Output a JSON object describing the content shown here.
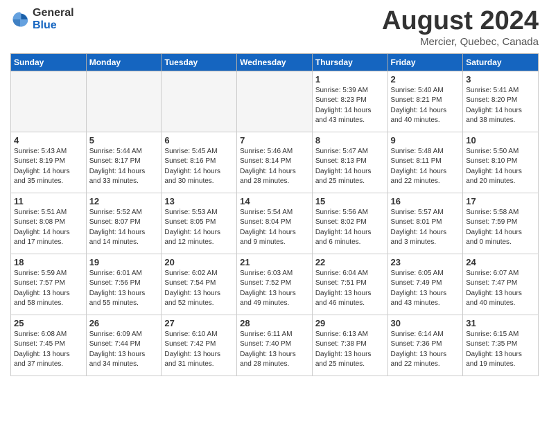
{
  "header": {
    "logo_line1": "General",
    "logo_line2": "Blue",
    "title": "August 2024",
    "subtitle": "Mercier, Quebec, Canada"
  },
  "weekdays": [
    "Sunday",
    "Monday",
    "Tuesday",
    "Wednesday",
    "Thursday",
    "Friday",
    "Saturday"
  ],
  "weeks": [
    [
      {
        "day": "",
        "info": ""
      },
      {
        "day": "",
        "info": ""
      },
      {
        "day": "",
        "info": ""
      },
      {
        "day": "",
        "info": ""
      },
      {
        "day": "1",
        "info": "Sunrise: 5:39 AM\nSunset: 8:23 PM\nDaylight: 14 hours\nand 43 minutes."
      },
      {
        "day": "2",
        "info": "Sunrise: 5:40 AM\nSunset: 8:21 PM\nDaylight: 14 hours\nand 40 minutes."
      },
      {
        "day": "3",
        "info": "Sunrise: 5:41 AM\nSunset: 8:20 PM\nDaylight: 14 hours\nand 38 minutes."
      }
    ],
    [
      {
        "day": "4",
        "info": "Sunrise: 5:43 AM\nSunset: 8:19 PM\nDaylight: 14 hours\nand 35 minutes."
      },
      {
        "day": "5",
        "info": "Sunrise: 5:44 AM\nSunset: 8:17 PM\nDaylight: 14 hours\nand 33 minutes."
      },
      {
        "day": "6",
        "info": "Sunrise: 5:45 AM\nSunset: 8:16 PM\nDaylight: 14 hours\nand 30 minutes."
      },
      {
        "day": "7",
        "info": "Sunrise: 5:46 AM\nSunset: 8:14 PM\nDaylight: 14 hours\nand 28 minutes."
      },
      {
        "day": "8",
        "info": "Sunrise: 5:47 AM\nSunset: 8:13 PM\nDaylight: 14 hours\nand 25 minutes."
      },
      {
        "day": "9",
        "info": "Sunrise: 5:48 AM\nSunset: 8:11 PM\nDaylight: 14 hours\nand 22 minutes."
      },
      {
        "day": "10",
        "info": "Sunrise: 5:50 AM\nSunset: 8:10 PM\nDaylight: 14 hours\nand 20 minutes."
      }
    ],
    [
      {
        "day": "11",
        "info": "Sunrise: 5:51 AM\nSunset: 8:08 PM\nDaylight: 14 hours\nand 17 minutes."
      },
      {
        "day": "12",
        "info": "Sunrise: 5:52 AM\nSunset: 8:07 PM\nDaylight: 14 hours\nand 14 minutes."
      },
      {
        "day": "13",
        "info": "Sunrise: 5:53 AM\nSunset: 8:05 PM\nDaylight: 14 hours\nand 12 minutes."
      },
      {
        "day": "14",
        "info": "Sunrise: 5:54 AM\nSunset: 8:04 PM\nDaylight: 14 hours\nand 9 minutes."
      },
      {
        "day": "15",
        "info": "Sunrise: 5:56 AM\nSunset: 8:02 PM\nDaylight: 14 hours\nand 6 minutes."
      },
      {
        "day": "16",
        "info": "Sunrise: 5:57 AM\nSunset: 8:01 PM\nDaylight: 14 hours\nand 3 minutes."
      },
      {
        "day": "17",
        "info": "Sunrise: 5:58 AM\nSunset: 7:59 PM\nDaylight: 14 hours\nand 0 minutes."
      }
    ],
    [
      {
        "day": "18",
        "info": "Sunrise: 5:59 AM\nSunset: 7:57 PM\nDaylight: 13 hours\nand 58 minutes."
      },
      {
        "day": "19",
        "info": "Sunrise: 6:01 AM\nSunset: 7:56 PM\nDaylight: 13 hours\nand 55 minutes."
      },
      {
        "day": "20",
        "info": "Sunrise: 6:02 AM\nSunset: 7:54 PM\nDaylight: 13 hours\nand 52 minutes."
      },
      {
        "day": "21",
        "info": "Sunrise: 6:03 AM\nSunset: 7:52 PM\nDaylight: 13 hours\nand 49 minutes."
      },
      {
        "day": "22",
        "info": "Sunrise: 6:04 AM\nSunset: 7:51 PM\nDaylight: 13 hours\nand 46 minutes."
      },
      {
        "day": "23",
        "info": "Sunrise: 6:05 AM\nSunset: 7:49 PM\nDaylight: 13 hours\nand 43 minutes."
      },
      {
        "day": "24",
        "info": "Sunrise: 6:07 AM\nSunset: 7:47 PM\nDaylight: 13 hours\nand 40 minutes."
      }
    ],
    [
      {
        "day": "25",
        "info": "Sunrise: 6:08 AM\nSunset: 7:45 PM\nDaylight: 13 hours\nand 37 minutes."
      },
      {
        "day": "26",
        "info": "Sunrise: 6:09 AM\nSunset: 7:44 PM\nDaylight: 13 hours\nand 34 minutes."
      },
      {
        "day": "27",
        "info": "Sunrise: 6:10 AM\nSunset: 7:42 PM\nDaylight: 13 hours\nand 31 minutes."
      },
      {
        "day": "28",
        "info": "Sunrise: 6:11 AM\nSunset: 7:40 PM\nDaylight: 13 hours\nand 28 minutes."
      },
      {
        "day": "29",
        "info": "Sunrise: 6:13 AM\nSunset: 7:38 PM\nDaylight: 13 hours\nand 25 minutes."
      },
      {
        "day": "30",
        "info": "Sunrise: 6:14 AM\nSunset: 7:36 PM\nDaylight: 13 hours\nand 22 minutes."
      },
      {
        "day": "31",
        "info": "Sunrise: 6:15 AM\nSunset: 7:35 PM\nDaylight: 13 hours\nand 19 minutes."
      }
    ]
  ]
}
